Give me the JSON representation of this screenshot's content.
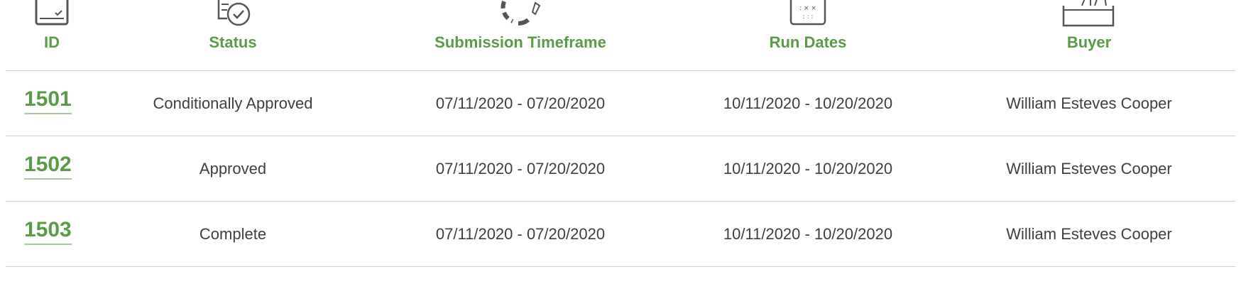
{
  "table": {
    "headers": [
      {
        "label": "ID",
        "icon": "form-icon"
      },
      {
        "label": "Status",
        "icon": "status-check-icon"
      },
      {
        "label": "Submission Timeframe",
        "icon": "timer-icon"
      },
      {
        "label": "Run Dates",
        "icon": "calendar-icon"
      },
      {
        "label": "Buyer",
        "icon": "buyer-icon"
      }
    ],
    "rows": [
      {
        "id": "1501",
        "status": "Conditionally Approved",
        "submission": "07/11/2020 - 07/20/2020",
        "run_dates": "10/11/2020 - 10/20/2020",
        "buyer": "William Esteves Cooper"
      },
      {
        "id": "1502",
        "status": "Approved",
        "submission": "07/11/2020 - 07/20/2020",
        "run_dates": "10/11/2020 - 10/20/2020",
        "buyer": "William Esteves Cooper"
      },
      {
        "id": "1503",
        "status": "Complete",
        "submission": "07/11/2020 - 07/20/2020",
        "run_dates": "10/11/2020 - 10/20/2020",
        "buyer": "William Esteves Cooper"
      }
    ]
  },
  "colors": {
    "accent": "#5a9a48",
    "text": "#3f3f3f",
    "divider": "#d3d3d3",
    "icon": "#555555"
  }
}
